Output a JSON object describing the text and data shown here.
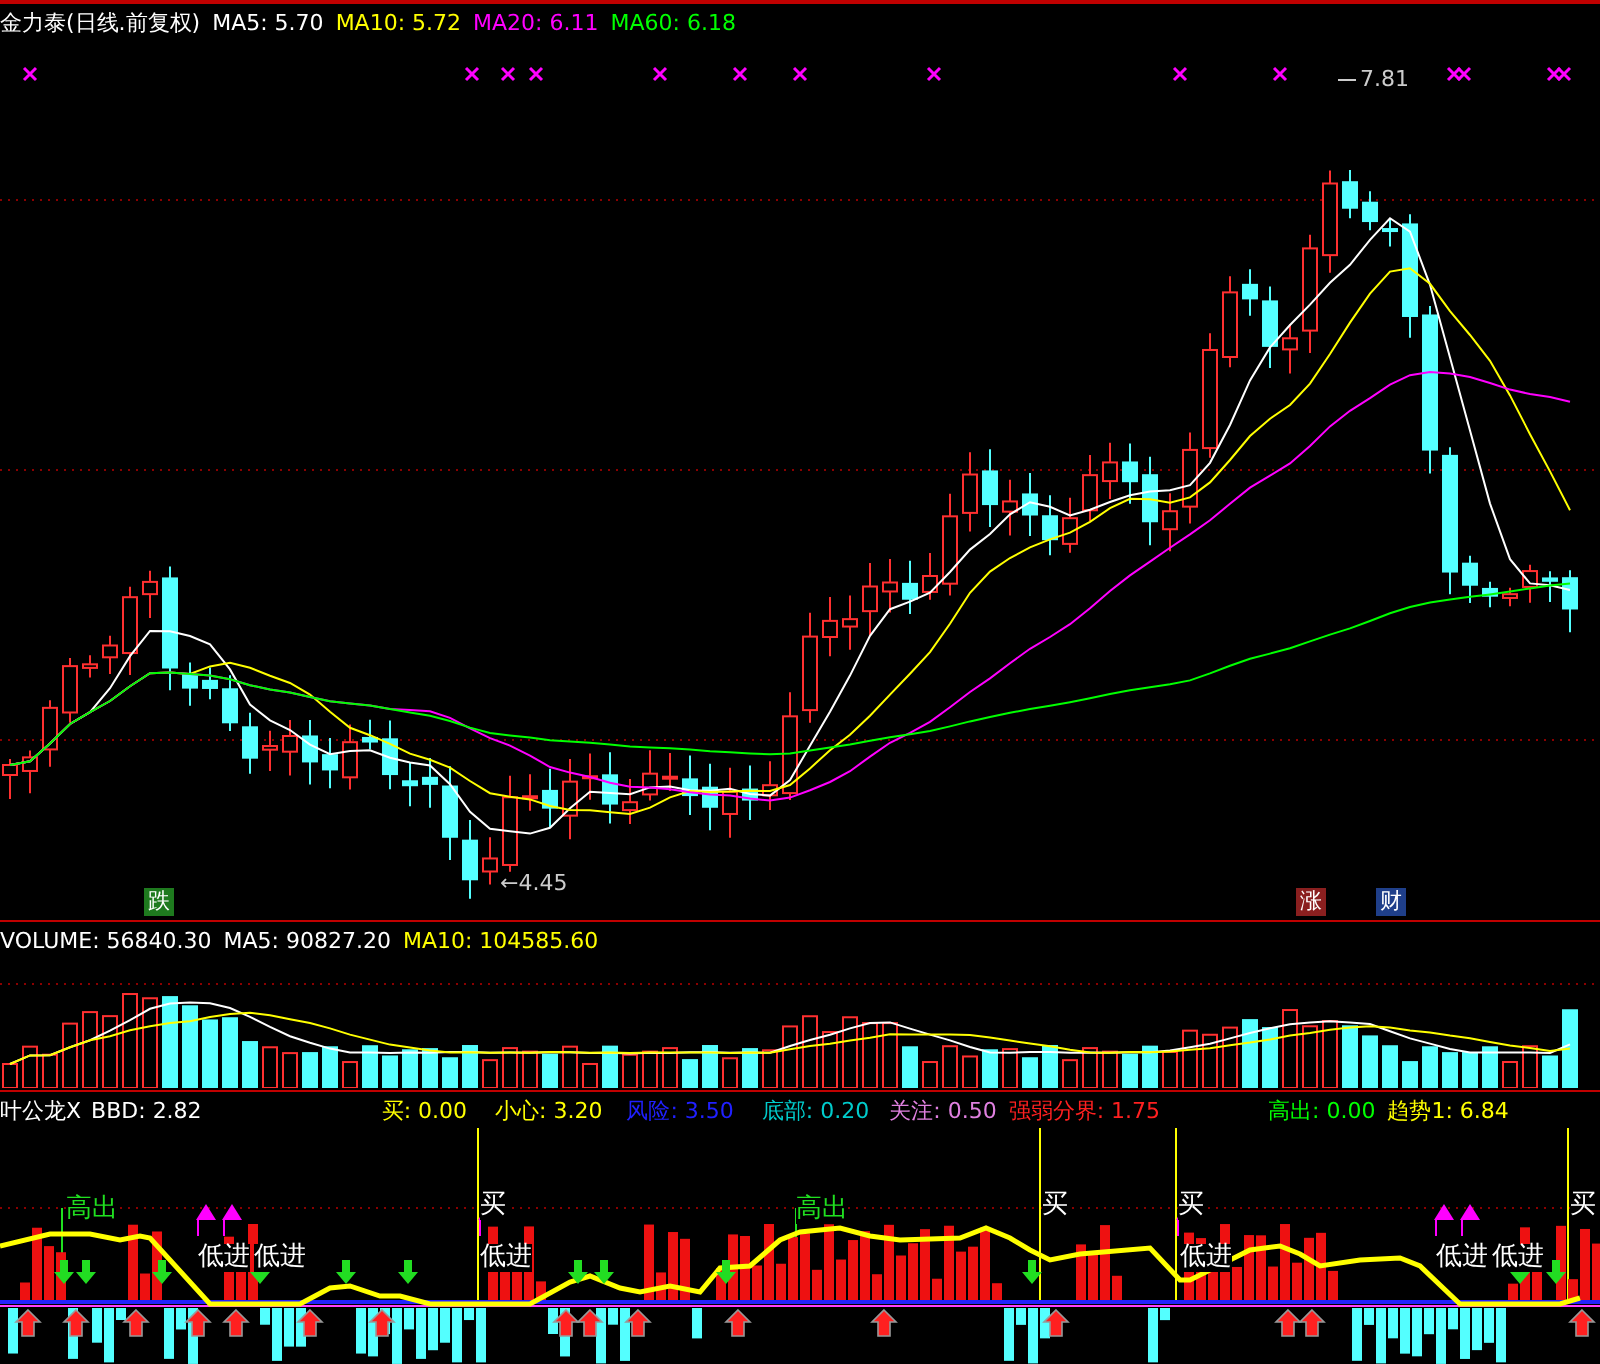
{
  "header": {
    "title": "金力泰(日线.前复权)",
    "indicators": [
      {
        "label": "MA5: 5.70",
        "color": "#ffffff"
      },
      {
        "label": "MA10: 5.72",
        "color": "#ffff00"
      },
      {
        "label": "MA20: 6.11",
        "color": "#ff00ff"
      },
      {
        "label": "MA60: 6.18",
        "color": "#00ff00"
      }
    ]
  },
  "price_chart": {
    "high_label": "7.81",
    "low_label": "←4.45",
    "badges": [
      {
        "text": "跌",
        "color": "#1e7a1e"
      },
      {
        "text": "涨",
        "color": "#8a1f1f"
      },
      {
        "text": "财",
        "color": "#1f3f8a"
      }
    ]
  },
  "volume": {
    "indicators": [
      {
        "label": "VOLUME: 56840.30",
        "color": "#ffffff"
      },
      {
        "label": "MA5: 90827.20",
        "color": "#ffffff"
      },
      {
        "label": "MA10: 104585.60",
        "color": "#ffff00"
      }
    ]
  },
  "indicator": {
    "name": "叶公龙X",
    "indicators": [
      {
        "label": "BBD: 2.82",
        "color": "#ffffff"
      },
      {
        "label": "买: 0.00",
        "color": "#ffff00"
      },
      {
        "label": "小心: 3.20",
        "color": "#ffff00"
      },
      {
        "label": "风险: 3.50",
        "color": "#2020ff"
      },
      {
        "label": "底部: 0.20",
        "color": "#00cccc"
      },
      {
        "label": "关注: 0.50",
        "color": "#e080e0"
      },
      {
        "label": "强弱分界: 1.75",
        "color": "#ff2020"
      },
      {
        "label": "高出: 0.00",
        "color": "#00ff00"
      },
      {
        "label": "趋势1: 6.84",
        "color": "#ffff00"
      }
    ],
    "signals": [
      {
        "text": "高出",
        "kind": "high"
      },
      {
        "text": "买",
        "kind": "buy"
      },
      {
        "text": "高出",
        "kind": "high"
      },
      {
        "text": "买",
        "kind": "buy"
      },
      {
        "text": "买",
        "kind": "buy"
      },
      {
        "text": "买",
        "kind": "buy"
      },
      {
        "text": "低进",
        "kind": "low"
      },
      {
        "text": "低进",
        "kind": "low"
      },
      {
        "text": "低进",
        "kind": "low"
      },
      {
        "text": "低进",
        "kind": "low"
      },
      {
        "text": "低进",
        "kind": "low"
      },
      {
        "text": "低进",
        "kind": "low"
      }
    ]
  }
}
